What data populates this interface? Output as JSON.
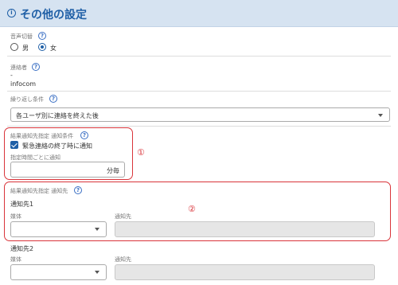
{
  "header": {
    "title": "その他の設定",
    "icon": "info-circle-icon"
  },
  "voice": {
    "label": "音声切替",
    "options": [
      {
        "label": "男",
        "checked": false
      },
      {
        "label": "女",
        "checked": true
      }
    ]
  },
  "contact_person": {
    "label": "連絡者",
    "values": [
      "-",
      "infocom"
    ]
  },
  "repeat": {
    "label": "繰り返し条件",
    "selected": "各ユーザ別に連絡を終えた後"
  },
  "result_condition": {
    "label": "結果通知先指定 通知条件",
    "checkbox_label": "緊急連絡の終了時に通知",
    "checkbox_checked": true,
    "interval_label": "指定時間ごとに通知",
    "interval_value": "",
    "interval_suffix": "分毎",
    "marker": "①"
  },
  "result_dest": {
    "label": "結果通知先指定 通知先",
    "marker": "②",
    "groups": [
      {
        "title": "通知先1",
        "media_label": "媒体",
        "media_value": "",
        "dest_label": "通知先",
        "dest_value": ""
      },
      {
        "title": "通知先2",
        "media_label": "媒体",
        "media_value": "",
        "dest_label": "通知先",
        "dest_value": ""
      }
    ]
  },
  "colors": {
    "accent": "#1f5fa6",
    "header_bg": "#d6e3f1",
    "highlight": "#d9343a"
  }
}
